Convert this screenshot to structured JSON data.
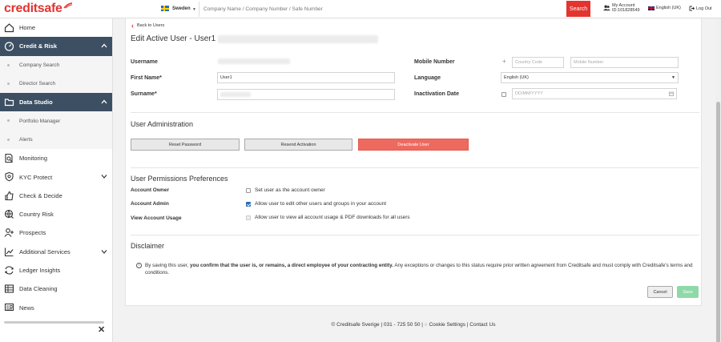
{
  "header": {
    "logo_text": "creditsafe",
    "country": "Sweden",
    "search_placeholder": "Company Name / Company Number / Safe Number",
    "search_label": "Search",
    "account_label": "My Account",
    "account_id": "ID:101828549",
    "language": "English (UK)",
    "logout": "Log Out",
    "brand_color": "#e3342f"
  },
  "sidebar": {
    "items": [
      {
        "label": "Home",
        "icon": "home-icon"
      },
      {
        "label": "Credit & Risk",
        "icon": "speedometer-icon"
      },
      {
        "label": "Company Search"
      },
      {
        "label": "Director Search"
      },
      {
        "label": "Data Studio",
        "icon": "folder-icon"
      },
      {
        "label": "Portfolio Manager"
      },
      {
        "label": "Alerts"
      },
      {
        "label": "Monitoring",
        "icon": "monitor-search-icon"
      },
      {
        "label": "KYC Protect",
        "icon": "shield-icon"
      },
      {
        "label": "Check & Decide",
        "icon": "thumbs-up-icon"
      },
      {
        "label": "Country Risk",
        "icon": "globe-icon"
      },
      {
        "label": "Prospects",
        "icon": "user-plus-icon"
      },
      {
        "label": "Additional Services",
        "icon": "chart-icon"
      },
      {
        "label": "Ledger Insights",
        "icon": "refresh-icon"
      },
      {
        "label": "Data Cleaning",
        "icon": "table-icon"
      },
      {
        "label": "News",
        "icon": "news-icon"
      }
    ],
    "active_color": "#3d4f63"
  },
  "form": {
    "back_label": "Back to Users",
    "title": "Edit Active User - User1",
    "username_label": "Username",
    "first_name_label": "First Name*",
    "first_name_value": "User1",
    "surname_label": "Surname*",
    "mobile_label": "Mobile Number",
    "country_code_placeholder": "Country Code",
    "mobile_placeholder": "Mobile Number",
    "language_label": "Language",
    "language_value": "English (UK)",
    "inactivation_label": "Inactivation Date",
    "date_placeholder": "DD/MM/YYYY"
  },
  "admin": {
    "title": "User Administration",
    "reset_label": "Reset Password",
    "resend_label": "Resend Activation",
    "deactivate_label": "Deactivate User"
  },
  "permissions": {
    "title": "User Permissions Preferences",
    "rows": [
      {
        "label": "Account Owner",
        "text": "Set user as the account owner",
        "checked": false
      },
      {
        "label": "Account Admin",
        "text": "Allow user to edit other users and groups in your account",
        "checked": true
      },
      {
        "label": "View Account Usage",
        "text": "Allow user to view all account usage & PDF downloads for all users",
        "checked": false
      }
    ]
  },
  "disclaimer": {
    "title": "Disclaimer",
    "text_start": "By saving this user, ",
    "text_bold": "you confirm that the user is, or remains, a direct employee of your contracting entity.",
    "text_end": " Any exceptions or changes to this status require prior written agreement from Creditsafe and must comply with Creditsafe's terms and conditions."
  },
  "actions": {
    "cancel_label": "Cancel",
    "save_label": "Save"
  },
  "footer": {
    "copyright": "© Creditsafe Sverige | 031 - 725 50 50 |",
    "cookie": "Cookie Settings",
    "separator": "|",
    "contact": "Contact Us"
  }
}
